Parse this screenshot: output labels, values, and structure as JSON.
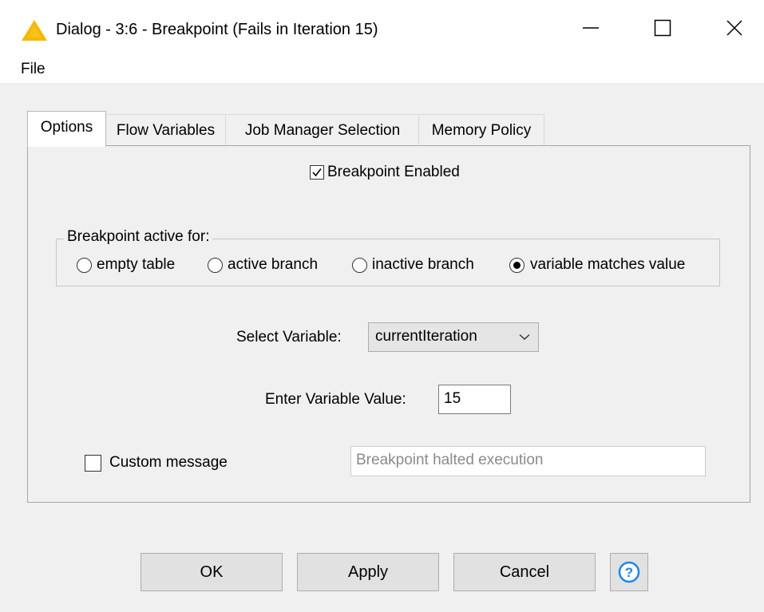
{
  "window": {
    "title": "Dialog - 3:6 - Breakpoint (Fails in Iteration 15)",
    "icon": "warning-triangle-icon",
    "accent_color": "#f5b800"
  },
  "menu": {
    "file_label": "File"
  },
  "tabs": [
    {
      "label": "Options",
      "active": true
    },
    {
      "label": "Flow Variables",
      "active": false
    },
    {
      "label": "Job Manager Selection",
      "active": false
    },
    {
      "label": "Memory Policy",
      "active": false
    }
  ],
  "options": {
    "breakpoint_enabled": {
      "label": "Breakpoint Enabled",
      "checked": true
    },
    "active_for": {
      "title": "Breakpoint active for:",
      "choices": [
        {
          "label": "empty table",
          "selected": false
        },
        {
          "label": "active branch",
          "selected": false
        },
        {
          "label": "inactive branch",
          "selected": false
        },
        {
          "label": "variable matches value",
          "selected": true
        }
      ]
    },
    "select_variable": {
      "label": "Select Variable:",
      "value": "currentIteration"
    },
    "variable_value": {
      "label": "Enter Variable Value:",
      "value": "15"
    },
    "custom_message": {
      "label": "Custom message",
      "checked": false,
      "value": "Breakpoint halted execution",
      "disabled": true
    }
  },
  "buttons": {
    "ok": "OK",
    "apply": "Apply",
    "cancel": "Cancel",
    "help_icon": "help-icon",
    "help_color": "#1e88e5"
  }
}
